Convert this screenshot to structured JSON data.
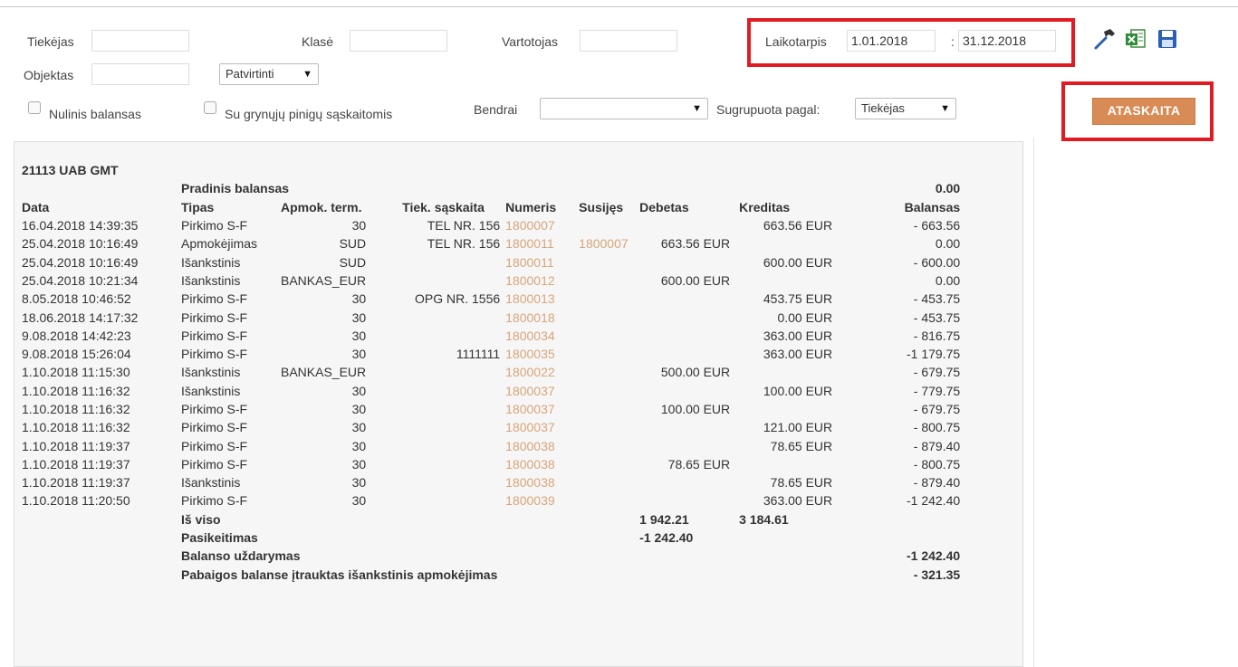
{
  "filters": {
    "supplier_label": "Tiekėjas",
    "supplier_value": "",
    "class_label": "Klasė",
    "class_value": "",
    "user_label": "Vartotojas",
    "user_value": "",
    "period_label": "Laikotarpis",
    "period_from": "1.01.2018",
    "period_sep": ":",
    "period_to": "31.12.2018",
    "object_label": "Objektas",
    "object_value": "",
    "status_select": "Patvirtinti",
    "zero_balance_label": "Nulinis balansas",
    "cash_accounts_label": "Su grynųjų pinigų sąskaitomis",
    "general_label": "Bendrai",
    "general_value": "",
    "grouped_by_label": "Sugrupuota pagal:",
    "grouped_by_value": "Tiekėjas",
    "report_button": "ATASKAITA",
    "arrow": "▼"
  },
  "icons": [
    "settings-hammer-icon",
    "excel-export-icon",
    "save-icon"
  ],
  "accent": {
    "highlight": "#e21b23",
    "button": "#d88b55",
    "link": "#d8a57a"
  },
  "report": {
    "group_title": "21113 UAB GMT",
    "opening_label": "Pradinis balansas",
    "opening_value": "0.00",
    "columns": [
      "Data",
      "Tipas",
      "Apmok. term.",
      "Tiek. sąskaita",
      "Numeris",
      "Susijęs",
      "Debetas",
      "Kreditas",
      "Balansas"
    ],
    "rows": [
      [
        "16.04.2018 14:39:35",
        "Pirkimo S-F",
        "30",
        "TEL NR. 156",
        "1800007",
        "",
        "",
        "663.56 EUR",
        "- 663.56"
      ],
      [
        "25.04.2018 10:16:49",
        "Apmokėjimas",
        "SUD",
        "TEL NR. 156",
        "1800011",
        "1800007",
        "663.56 EUR",
        "",
        "0.00"
      ],
      [
        "25.04.2018 10:16:49",
        "Išankstinis",
        "SUD",
        "",
        "1800011",
        "",
        "",
        "600.00 EUR",
        "- 600.00"
      ],
      [
        "25.04.2018 10:21:34",
        "Išankstinis",
        "BANKAS_EUR",
        "",
        "1800012",
        "",
        "600.00 EUR",
        "",
        "0.00"
      ],
      [
        "8.05.2018 10:46:52",
        "Pirkimo S-F",
        "30",
        "OPG NR. 1556",
        "1800013",
        "",
        "",
        "453.75 EUR",
        "- 453.75"
      ],
      [
        "18.06.2018 14:17:32",
        "Pirkimo S-F",
        "30",
        "",
        "1800018",
        "",
        "",
        "0.00 EUR",
        "- 453.75"
      ],
      [
        "9.08.2018 14:42:23",
        "Pirkimo S-F",
        "30",
        "",
        "1800034",
        "",
        "",
        "363.00 EUR",
        "- 816.75"
      ],
      [
        "9.08.2018 15:26:04",
        "Pirkimo S-F",
        "30",
        "1111111",
        "1800035",
        "",
        "",
        "363.00 EUR",
        "-1 179.75"
      ],
      [
        "1.10.2018 11:15:30",
        "Išankstinis",
        "BANKAS_EUR",
        "",
        "1800022",
        "",
        "500.00 EUR",
        "",
        "- 679.75"
      ],
      [
        "1.10.2018 11:16:32",
        "Išankstinis",
        "30",
        "",
        "1800037",
        "",
        "",
        "100.00 EUR",
        "- 779.75"
      ],
      [
        "1.10.2018 11:16:32",
        "Pirkimo S-F",
        "30",
        "",
        "1800037",
        "",
        "100.00 EUR",
        "",
        "- 679.75"
      ],
      [
        "1.10.2018 11:16:32",
        "Pirkimo S-F",
        "30",
        "",
        "1800037",
        "",
        "",
        "121.00 EUR",
        "- 800.75"
      ],
      [
        "1.10.2018 11:19:37",
        "Pirkimo S-F",
        "30",
        "",
        "1800038",
        "",
        "",
        "78.65 EUR",
        "- 879.40"
      ],
      [
        "1.10.2018 11:19:37",
        "Pirkimo S-F",
        "30",
        "",
        "1800038",
        "",
        "78.65 EUR",
        "",
        "- 800.75"
      ],
      [
        "1.10.2018 11:19:37",
        "Išankstinis",
        "30",
        "",
        "1800038",
        "",
        "",
        "78.65 EUR",
        "- 879.40"
      ],
      [
        "1.10.2018 11:20:50",
        "Pirkimo S-F",
        "30",
        "",
        "1800039",
        "",
        "",
        "363.00 EUR",
        "-1 242.40"
      ]
    ],
    "total_label": "Iš viso",
    "total_debit": "1 942.21",
    "total_credit": "3 184.61",
    "change_label": "Pasikeitimas",
    "change_value": "-1 242.40",
    "closing_label": "Balanso uždarymas",
    "closing_value": "-1 242.40",
    "prepayment_label": "Pabaigos balanse įtrauktas išankstinis apmokėjimas",
    "prepayment_value": "- 321.35"
  }
}
